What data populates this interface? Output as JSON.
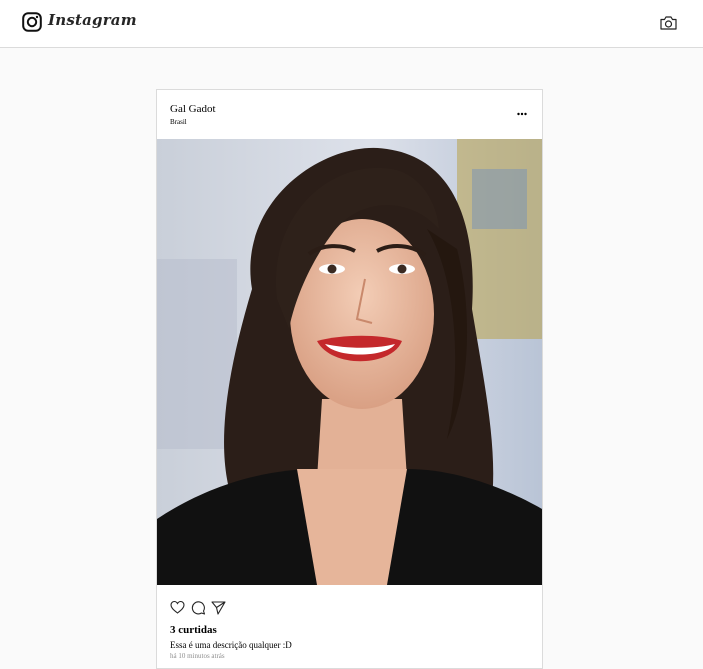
{
  "header": {
    "brand": "Instagram",
    "logo_icon": "instagram-glyph-icon",
    "camera_icon": "camera-icon"
  },
  "post": {
    "username": "Gal Gadot",
    "location": "Brasil",
    "more_icon": "more-options-icon",
    "image_alt": "Gal Gadot",
    "actions": [
      "heart-icon",
      "comment-icon",
      "share-icon"
    ],
    "likes": "3 curtidas",
    "description": "Essa é uma descrição qualquer :D",
    "date": "há 10 minutos atrás"
  },
  "colors": {
    "background": "#fafafa",
    "border": "#dbdbdb",
    "text": "#262626",
    "muted": "#8e8e8e"
  }
}
